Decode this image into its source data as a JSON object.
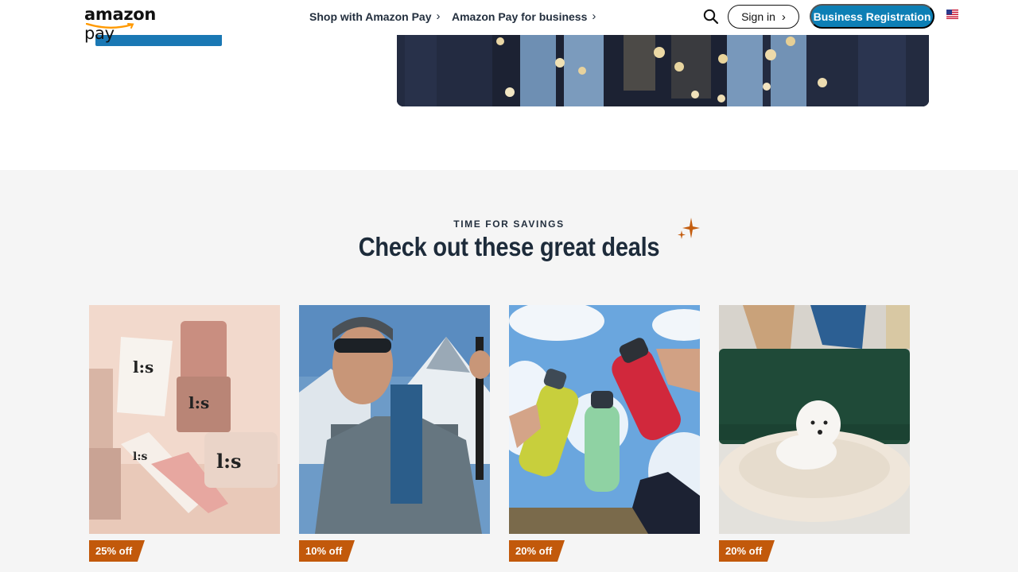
{
  "nav": {
    "logo_word1": "amazon",
    "logo_word2": " pay",
    "links": [
      {
        "label": "Shop with Amazon Pay"
      },
      {
        "label": "Amazon Pay for business"
      }
    ],
    "signin_label": "Sign in",
    "business_registration_label": "Business Registration",
    "search_icon": "search-icon",
    "flag_icon": "us-flag-icon"
  },
  "deals": {
    "eyebrow": "TIME FOR SAVINGS",
    "title": "Check out these great deals",
    "cards": [
      {
        "image": "beauty-products-image",
        "discount": "25% off"
      },
      {
        "image": "hiker-image",
        "discount": "10% off"
      },
      {
        "image": "water-bottles-image",
        "discount": "20% off"
      },
      {
        "image": "dog-bed-image",
        "discount": "20% off"
      }
    ]
  },
  "colors": {
    "accent_blue": "#0d7fb5",
    "discount_orange": "#c2590b",
    "section_bg": "#f5f5f5",
    "text_dark": "#232f3e"
  }
}
